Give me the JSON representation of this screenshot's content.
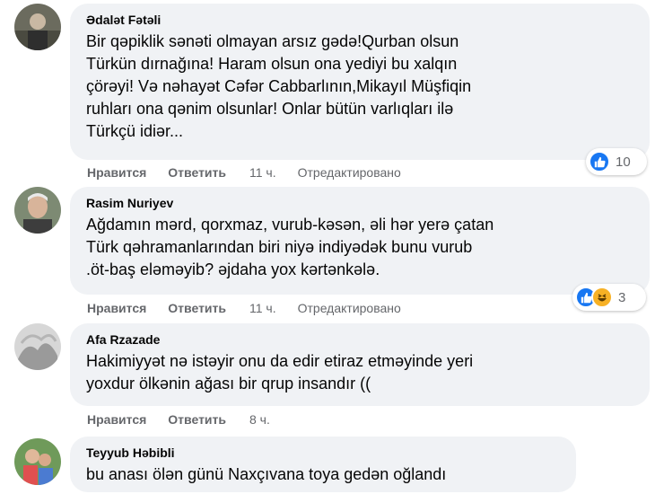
{
  "colors": {
    "bubble_bg": "#f0f2f5",
    "action_text": "#65676b",
    "like_blue": "#1877f2",
    "haha_yellow": "#f7b125"
  },
  "actions": {
    "like_label": "Нравится",
    "reply_label": "Ответить",
    "edited_label": "Отредактировано"
  },
  "comments": [
    {
      "author": "Ədalət Fətəli",
      "text": "Bir qəpiklik sənəti olmayan arsız gədə!Qurban olsun\nTürkün dırnağına! Haram olsun ona yediyi bu xalqın\nçörəyi! Və nəhayət Cəfər Cabbarlının,Mikayıl Müşfiqin\nruhları ona qənim olsunlar! Onlar bütün varlıqları ilə\nTürkçü idiər...",
      "time": "11 ч.",
      "edited": true,
      "reactions": {
        "icons": [
          "like-icon"
        ],
        "count": "10"
      }
    },
    {
      "author": "Rasim Nuriyev",
      "text": "Ağdamın mərd, qorxmaz, vurub-kəsən, əli hər yerə çatan\nTürk qəhramanlarından biri niyə indiyədək bunu vurub\n.öt-baş eləməyib? əjdaha yox kərtənkələ.",
      "time": "11 ч.",
      "edited": true,
      "reactions": {
        "icons": [
          "like-icon",
          "haha-icon"
        ],
        "count": "3"
      }
    },
    {
      "author": "Afa Rzazade",
      "text": "Hakimiyyət nə istəyir onu da edir etiraz etməyinde yeri\nyoxdur ölkənin ağası bir qrup insandır ((",
      "time": "8 ч.",
      "edited": false
    },
    {
      "author": "Teyyub Həbibli",
      "text": "bu anası ölən günü Naxçıvana toya gedən oğlandı"
    }
  ]
}
